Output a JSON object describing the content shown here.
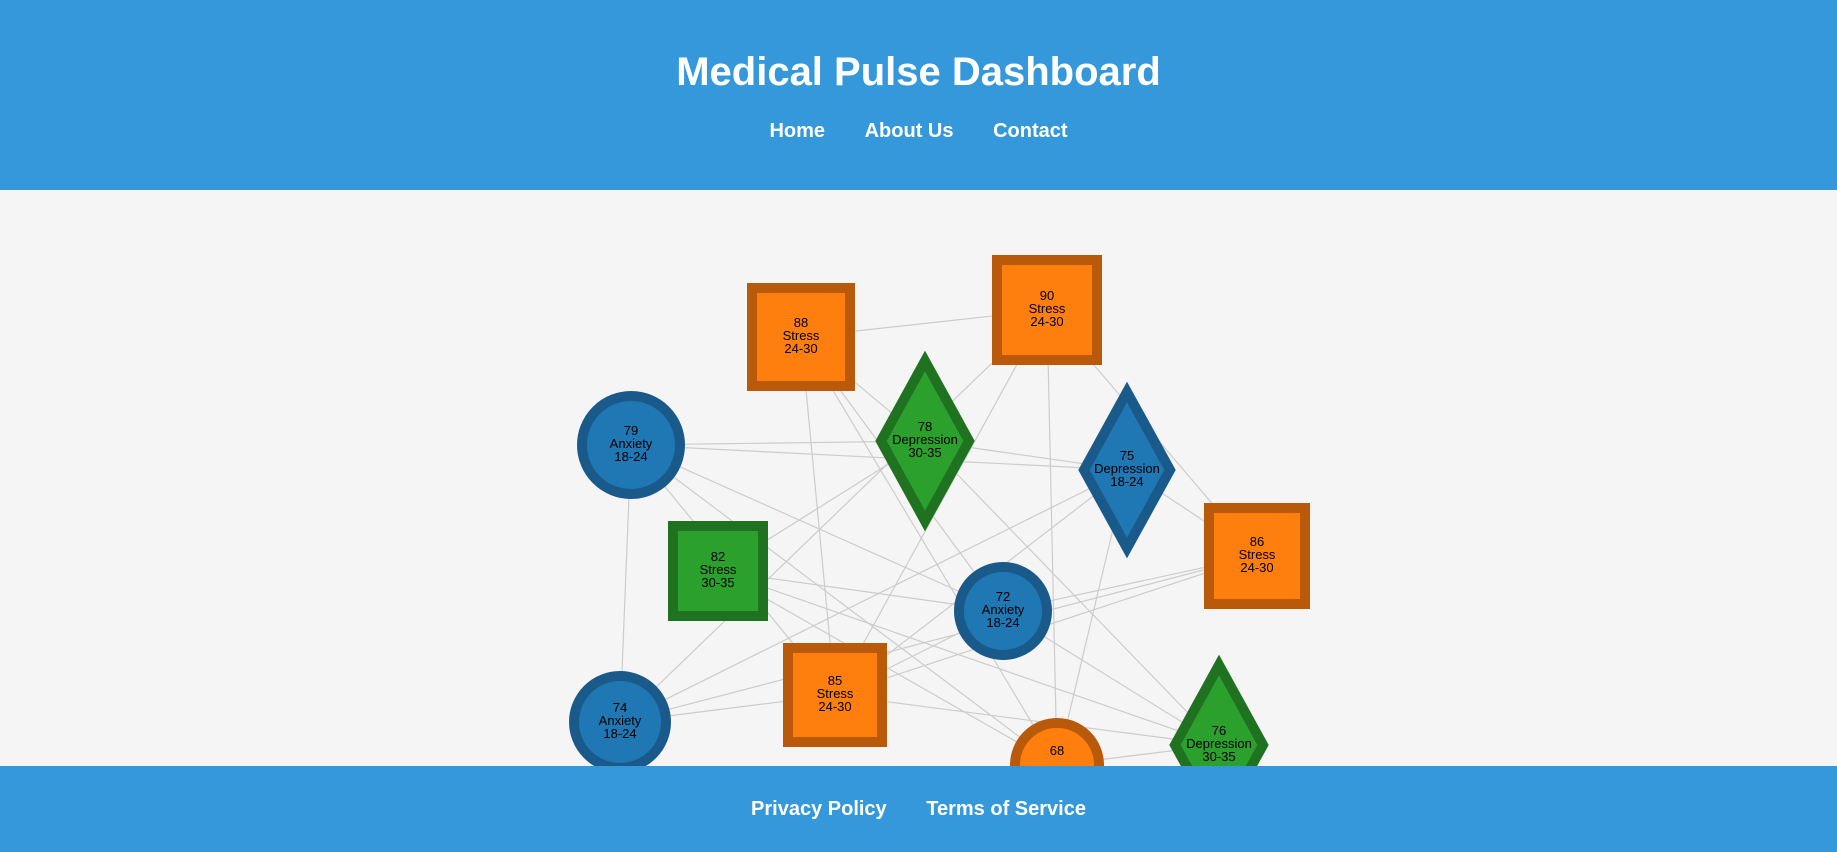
{
  "header": {
    "title": "Medical Pulse Dashboard",
    "nav": [
      {
        "label": "Home"
      },
      {
        "label": "About Us"
      },
      {
        "label": "Contact"
      }
    ]
  },
  "footer": {
    "links": [
      {
        "label": "Privacy Policy"
      },
      {
        "label": "Terms of Service"
      }
    ]
  },
  "colors": {
    "header_bg": "#3498db",
    "page_bg": "#f5f5f5",
    "anxiety": "#1f77b4",
    "stress": "#ff7f0e",
    "depression": "#2ca02c",
    "edge": "#cccccc"
  },
  "graph": {
    "nodes": [
      {
        "id": "n1",
        "value": "88",
        "condition": "Stress",
        "age": "24-30",
        "shape": "square",
        "color": "stress"
      },
      {
        "id": "n2",
        "value": "90",
        "condition": "Stress",
        "age": "24-30",
        "shape": "square",
        "color": "stress"
      },
      {
        "id": "n3",
        "value": "79",
        "condition": "Anxiety",
        "age": "18-24",
        "shape": "circle",
        "color": "anxiety"
      },
      {
        "id": "n4",
        "value": "78",
        "condition": "Depression",
        "age": "30-35",
        "shape": "diamond",
        "color": "depression"
      },
      {
        "id": "n5",
        "value": "75",
        "condition": "Depression",
        "age": "18-24",
        "shape": "diamond",
        "color": "anxiety"
      },
      {
        "id": "n6",
        "value": "86",
        "condition": "Stress",
        "age": "24-30",
        "shape": "square",
        "color": "stress"
      },
      {
        "id": "n7",
        "value": "82",
        "condition": "Stress",
        "age": "30-35",
        "shape": "square",
        "color": "depression"
      },
      {
        "id": "n8",
        "value": "72",
        "condition": "Anxiety",
        "age": "18-24",
        "shape": "circle",
        "color": "anxiety"
      },
      {
        "id": "n9",
        "value": "85",
        "condition": "Stress",
        "age": "24-30",
        "shape": "square",
        "color": "stress"
      },
      {
        "id": "n10",
        "value": "74",
        "condition": "Anxiety",
        "age": "18-24",
        "shape": "circle",
        "color": "anxiety"
      },
      {
        "id": "n11",
        "value": "76",
        "condition": "Depression",
        "age": "30-35",
        "shape": "diamond",
        "color": "depression"
      },
      {
        "id": "n12",
        "value": "68",
        "condition": "",
        "age": "",
        "shape": "circle",
        "color": "stress"
      }
    ],
    "edges": [
      [
        "n1",
        "n2"
      ],
      [
        "n1",
        "n9"
      ],
      [
        "n1",
        "n8"
      ],
      [
        "n1",
        "n12"
      ],
      [
        "n2",
        "n9"
      ],
      [
        "n2",
        "n6"
      ],
      [
        "n2",
        "n12"
      ],
      [
        "n2",
        "n10"
      ],
      [
        "n3",
        "n4"
      ],
      [
        "n3",
        "n5"
      ],
      [
        "n3",
        "n8"
      ],
      [
        "n3",
        "n10"
      ],
      [
        "n3",
        "n12"
      ],
      [
        "n4",
        "n7"
      ],
      [
        "n4",
        "n11"
      ],
      [
        "n4",
        "n5"
      ],
      [
        "n5",
        "n9"
      ],
      [
        "n5",
        "n6"
      ],
      [
        "n5",
        "n10"
      ],
      [
        "n5",
        "n12"
      ],
      [
        "n6",
        "n8"
      ],
      [
        "n6",
        "n10"
      ],
      [
        "n6",
        "n9"
      ],
      [
        "n7",
        "n11"
      ],
      [
        "n7",
        "n8"
      ],
      [
        "n7",
        "n12"
      ],
      [
        "n8",
        "n9"
      ],
      [
        "n8",
        "n11"
      ],
      [
        "n9",
        "n11"
      ],
      [
        "n9",
        "n10"
      ],
      [
        "n11",
        "n12"
      ],
      [
        "n3",
        "n9"
      ],
      [
        "n1",
        "n4"
      ]
    ]
  }
}
